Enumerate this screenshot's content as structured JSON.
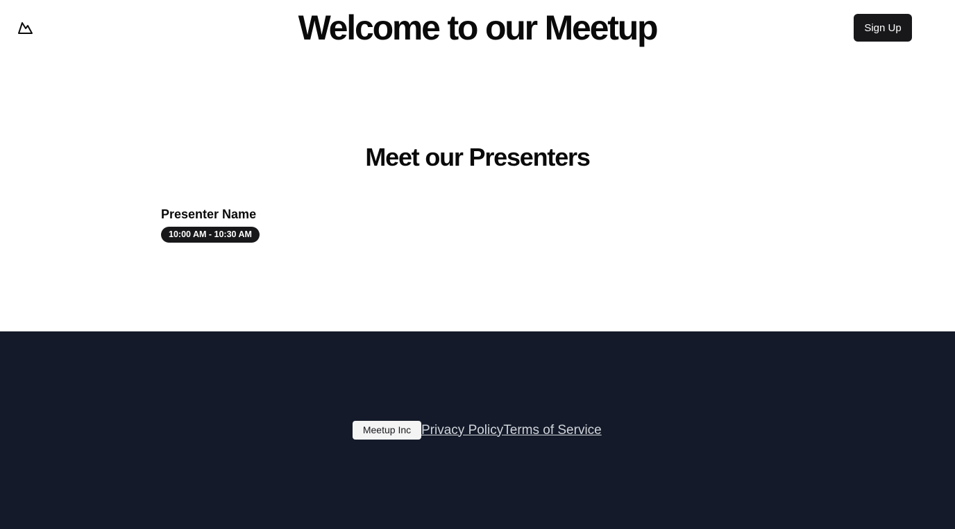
{
  "header": {
    "logo_icon": "mountain-icon",
    "title": "Welcome to our Meetup",
    "signup_label": "Sign Up"
  },
  "presenters": {
    "title": "Meet our Presenters",
    "items": [
      {
        "name": "Presenter Name",
        "time": "10:00 AM - 10:30 AM"
      }
    ]
  },
  "footer": {
    "company": "Meetup Inc",
    "links": [
      "Privacy Policy",
      "Terms of Service"
    ]
  },
  "colors": {
    "primary_dark": "#18181b",
    "footer_bg": "#141a29",
    "link": "#d1d5db"
  }
}
